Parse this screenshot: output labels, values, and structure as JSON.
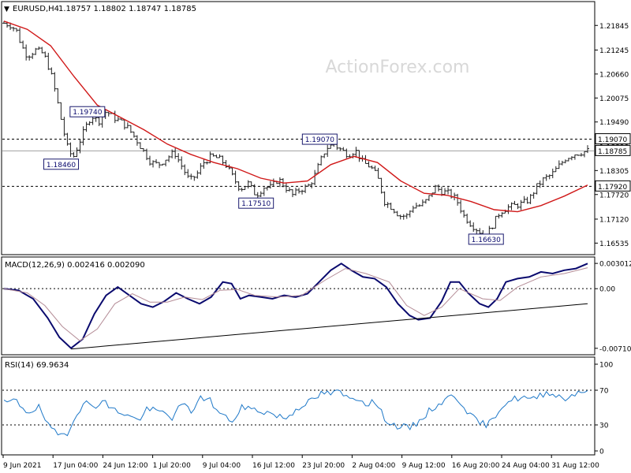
{
  "watermark": "ActionForex.com",
  "header": {
    "symbol": "EURUSD,H4",
    "ohlc": "1.18757 1.18802 1.18747 1.18785"
  },
  "colors": {
    "bar": "#202020",
    "sma": "#d01818",
    "macd": "#0a0a6e",
    "signal": "#b48c96",
    "rsi": "#1e78c8",
    "grid": "#000000",
    "tag_text": "#0a0a6e",
    "watermark": "#d8d8d8"
  },
  "chart_data": [
    {
      "type": "ohlc",
      "name": "price",
      "symbol": "EURUSD",
      "timeframe": "H4",
      "ylim": [
        1.1635,
        1.2235
      ],
      "yticks": [
        "1.21845",
        "1.21245",
        "1.20660",
        "1.20075",
        "1.19490",
        "1.18890",
        "1.18305",
        "1.17720",
        "1.17120",
        "1.16535"
      ],
      "current_price": "1.18785",
      "hlines": [
        {
          "value": 1.1907,
          "label": "1.19070",
          "style": "dashed"
        },
        {
          "value": 1.1792,
          "label": "1.17920",
          "style": "dashed"
        },
        {
          "value": 1.18785,
          "style": "solid-grey"
        }
      ],
      "annotations": [
        {
          "text": "1.19740",
          "x": 0.143,
          "y": 1.1974
        },
        {
          "text": "1.18460",
          "x": 0.098,
          "y": 1.1846
        },
        {
          "text": "1.17510",
          "x": 0.432,
          "y": 1.1751
        },
        {
          "text": "1.19070",
          "x": 0.541,
          "y": 1.1907
        },
        {
          "text": "1.16630",
          "x": 0.826,
          "y": 1.1663
        }
      ],
      "close_path": [
        [
          0.0,
          1.219
        ],
        [
          0.012,
          1.2185
        ],
        [
          0.022,
          1.217
        ],
        [
          0.03,
          1.2135
        ],
        [
          0.04,
          1.211
        ],
        [
          0.055,
          1.2125
        ],
        [
          0.068,
          1.2115
        ],
        [
          0.08,
          1.207
        ],
        [
          0.09,
          1.201
        ],
        [
          0.098,
          1.1955
        ],
        [
          0.108,
          1.189
        ],
        [
          0.118,
          1.186
        ],
        [
          0.128,
          1.1895
        ],
        [
          0.138,
          1.193
        ],
        [
          0.15,
          1.1965
        ],
        [
          0.162,
          1.195
        ],
        [
          0.175,
          1.1975
        ],
        [
          0.188,
          1.196
        ],
        [
          0.2,
          1.195
        ],
        [
          0.212,
          1.1935
        ],
        [
          0.225,
          1.191
        ],
        [
          0.238,
          1.188
        ],
        [
          0.252,
          1.185
        ],
        [
          0.265,
          1.1845
        ],
        [
          0.278,
          1.186
        ],
        [
          0.292,
          1.1875
        ],
        [
          0.305,
          1.184
        ],
        [
          0.318,
          1.1805
        ],
        [
          0.33,
          1.182
        ],
        [
          0.342,
          1.185
        ],
        [
          0.355,
          1.1865
        ],
        [
          0.368,
          1.186
        ],
        [
          0.38,
          1.1845
        ],
        [
          0.392,
          1.1815
        ],
        [
          0.405,
          1.1785
        ],
        [
          0.418,
          1.18
        ],
        [
          0.432,
          1.177
        ],
        [
          0.445,
          1.179
        ],
        [
          0.458,
          1.179
        ],
        [
          0.47,
          1.181
        ],
        [
          0.482,
          1.179
        ],
        [
          0.495,
          1.177
        ],
        [
          0.508,
          1.1785
        ],
        [
          0.52,
          1.179
        ],
        [
          0.53,
          1.181
        ],
        [
          0.541,
          1.185
        ],
        [
          0.552,
          1.1885
        ],
        [
          0.565,
          1.1895
        ],
        [
          0.578,
          1.188
        ],
        [
          0.59,
          1.187
        ],
        [
          0.602,
          1.188
        ],
        [
          0.615,
          1.185
        ],
        [
          0.628,
          1.184
        ],
        [
          0.64,
          1.1815
        ],
        [
          0.652,
          1.1755
        ],
        [
          0.665,
          1.174
        ],
        [
          0.678,
          1.172
        ],
        [
          0.69,
          1.172
        ],
        [
          0.702,
          1.1745
        ],
        [
          0.714,
          1.1745
        ],
        [
          0.726,
          1.176
        ],
        [
          0.738,
          1.179
        ],
        [
          0.75,
          1.178
        ],
        [
          0.762,
          1.1775
        ],
        [
          0.775,
          1.176
        ],
        [
          0.788,
          1.172
        ],
        [
          0.8,
          1.17
        ],
        [
          0.812,
          1.1685
        ],
        [
          0.826,
          1.167
        ],
        [
          0.838,
          1.17
        ],
        [
          0.85,
          1.173
        ],
        [
          0.862,
          1.174
        ],
        [
          0.875,
          1.1745
        ],
        [
          0.888,
          1.175
        ],
        [
          0.9,
          1.176
        ],
        [
          0.912,
          1.179
        ],
        [
          0.925,
          1.181
        ],
        [
          0.938,
          1.182
        ],
        [
          0.95,
          1.184
        ],
        [
          0.962,
          1.186
        ],
        [
          0.975,
          1.187
        ],
        [
          1.0,
          1.18785
        ]
      ],
      "sma_path": [
        [
          0.0,
          1.2195
        ],
        [
          0.04,
          1.2175
        ],
        [
          0.08,
          1.2135
        ],
        [
          0.12,
          1.206
        ],
        [
          0.16,
          1.199
        ],
        [
          0.2,
          1.196
        ],
        [
          0.24,
          1.193
        ],
        [
          0.28,
          1.1895
        ],
        [
          0.32,
          1.187
        ],
        [
          0.36,
          1.185
        ],
        [
          0.4,
          1.1835
        ],
        [
          0.44,
          1.1812
        ],
        [
          0.48,
          1.18
        ],
        [
          0.52,
          1.1805
        ],
        [
          0.56,
          1.1845
        ],
        [
          0.6,
          1.1865
        ],
        [
          0.64,
          1.185
        ],
        [
          0.68,
          1.1805
        ],
        [
          0.72,
          1.1775
        ],
        [
          0.76,
          1.177
        ],
        [
          0.8,
          1.1755
        ],
        [
          0.84,
          1.1735
        ],
        [
          0.88,
          1.173
        ],
        [
          0.92,
          1.1745
        ],
        [
          0.96,
          1.1768
        ],
        [
          1.0,
          1.1795
        ]
      ]
    },
    {
      "type": "line",
      "name": "macd",
      "label": "MACD(12,26,9) 0.002416 0.002090",
      "ylim": [
        -0.0075,
        0.0034
      ],
      "yticks": [
        "0.003012",
        "0.00",
        "-0.007109"
      ],
      "series": [
        {
          "role": "macd",
          "points": [
            [
              0.0,
              0.0
            ],
            [
              0.025,
              -0.0002
            ],
            [
              0.05,
              -0.0012
            ],
            [
              0.075,
              -0.0035
            ],
            [
              0.095,
              -0.0058
            ],
            [
              0.115,
              -0.0071
            ],
            [
              0.135,
              -0.006
            ],
            [
              0.155,
              -0.003
            ],
            [
              0.175,
              -0.0008
            ],
            [
              0.195,
              0.0002
            ],
            [
              0.215,
              -0.0008
            ],
            [
              0.235,
              -0.0018
            ],
            [
              0.255,
              -0.0022
            ],
            [
              0.275,
              -0.0015
            ],
            [
              0.295,
              -0.0005
            ],
            [
              0.315,
              -0.0012
            ],
            [
              0.335,
              -0.0018
            ],
            [
              0.355,
              -0.001
            ],
            [
              0.375,
              0.0008
            ],
            [
              0.39,
              0.0006
            ],
            [
              0.405,
              -0.0012
            ],
            [
              0.42,
              -0.0008
            ],
            [
              0.44,
              -0.001
            ],
            [
              0.46,
              -0.0012
            ],
            [
              0.48,
              -0.0008
            ],
            [
              0.5,
              -0.001
            ],
            [
              0.52,
              -0.0006
            ],
            [
              0.54,
              0.0008
            ],
            [
              0.56,
              0.0022
            ],
            [
              0.578,
              0.003
            ],
            [
              0.595,
              0.0022
            ],
            [
              0.615,
              0.0014
            ],
            [
              0.635,
              0.0012
            ],
            [
              0.655,
              0.0002
            ],
            [
              0.675,
              -0.0018
            ],
            [
              0.695,
              -0.0032
            ],
            [
              0.71,
              -0.0037
            ],
            [
              0.73,
              -0.0035
            ],
            [
              0.75,
              -0.0015
            ],
            [
              0.765,
              0.0008
            ],
            [
              0.78,
              0.0008
            ],
            [
              0.795,
              -0.0005
            ],
            [
              0.815,
              -0.0018
            ],
            [
              0.83,
              -0.0022
            ],
            [
              0.845,
              -0.0012
            ],
            [
              0.86,
              0.0008
            ],
            [
              0.88,
              0.0012
            ],
            [
              0.9,
              0.0014
            ],
            [
              0.92,
              0.002
            ],
            [
              0.94,
              0.0018
            ],
            [
              0.96,
              0.0022
            ],
            [
              0.98,
              0.0024
            ],
            [
              1.0,
              0.003
            ]
          ]
        },
        {
          "role": "signal",
          "points": [
            [
              0.0,
              0.0
            ],
            [
              0.04,
              -0.0005
            ],
            [
              0.07,
              -0.002
            ],
            [
              0.1,
              -0.0045
            ],
            [
              0.13,
              -0.0062
            ],
            [
              0.16,
              -0.0048
            ],
            [
              0.19,
              -0.0018
            ],
            [
              0.22,
              -0.0006
            ],
            [
              0.25,
              -0.0016
            ],
            [
              0.28,
              -0.0016
            ],
            [
              0.31,
              -0.001
            ],
            [
              0.34,
              -0.0013
            ],
            [
              0.37,
              -0.0002
            ],
            [
              0.4,
              -0.0001
            ],
            [
              0.43,
              -0.0008
            ],
            [
              0.47,
              -0.001
            ],
            [
              0.51,
              -0.0008
            ],
            [
              0.55,
              0.001
            ],
            [
              0.585,
              0.0024
            ],
            [
              0.62,
              0.0018
            ],
            [
              0.66,
              0.0008
            ],
            [
              0.69,
              -0.002
            ],
            [
              0.72,
              -0.0032
            ],
            [
              0.75,
              -0.0022
            ],
            [
              0.78,
              0.0
            ],
            [
              0.82,
              -0.0012
            ],
            [
              0.85,
              -0.0014
            ],
            [
              0.88,
              0.0002
            ],
            [
              0.92,
              0.0014
            ],
            [
              0.96,
              0.0018
            ],
            [
              1.0,
              0.0025
            ]
          ]
        },
        {
          "role": "trendline",
          "points": [
            [
              0.115,
              -0.0072
            ],
            [
              1.0,
              -0.0018
            ]
          ]
        }
      ]
    },
    {
      "type": "line",
      "name": "rsi",
      "label": "RSI(14) 69.9634",
      "ylim": [
        0,
        100
      ],
      "yticks": [
        "100",
        "70",
        "30",
        "0"
      ],
      "levels": [
        70,
        30
      ],
      "points": [
        [
          0.0,
          55
        ],
        [
          0.02,
          58
        ],
        [
          0.04,
          45
        ],
        [
          0.06,
          50
        ],
        [
          0.08,
          24
        ],
        [
          0.095,
          18
        ],
        [
          0.11,
          22
        ],
        [
          0.125,
          45
        ],
        [
          0.14,
          55
        ],
        [
          0.155,
          52
        ],
        [
          0.17,
          58
        ],
        [
          0.185,
          48
        ],
        [
          0.2,
          45
        ],
        [
          0.215,
          40
        ],
        [
          0.23,
          35
        ],
        [
          0.245,
          48
        ],
        [
          0.26,
          46
        ],
        [
          0.275,
          44
        ],
        [
          0.29,
          38
        ],
        [
          0.305,
          55
        ],
        [
          0.32,
          45
        ],
        [
          0.335,
          60
        ],
        [
          0.35,
          62
        ],
        [
          0.365,
          46
        ],
        [
          0.38,
          38
        ],
        [
          0.395,
          35
        ],
        [
          0.41,
          52
        ],
        [
          0.425,
          48
        ],
        [
          0.44,
          46
        ],
        [
          0.455,
          44
        ],
        [
          0.47,
          40
        ],
        [
          0.485,
          38
        ],
        [
          0.5,
          48
        ],
        [
          0.515,
          55
        ],
        [
          0.53,
          58
        ],
        [
          0.545,
          67
        ],
        [
          0.56,
          66
        ],
        [
          0.575,
          68
        ],
        [
          0.59,
          60
        ],
        [
          0.605,
          62
        ],
        [
          0.62,
          55
        ],
        [
          0.635,
          57
        ],
        [
          0.65,
          40
        ],
        [
          0.665,
          30
        ],
        [
          0.68,
          28
        ],
        [
          0.695,
          26
        ],
        [
          0.71,
          33
        ],
        [
          0.725,
          44
        ],
        [
          0.74,
          52
        ],
        [
          0.755,
          58
        ],
        [
          0.77,
          65
        ],
        [
          0.785,
          55
        ],
        [
          0.8,
          40
        ],
        [
          0.815,
          32
        ],
        [
          0.83,
          30
        ],
        [
          0.845,
          45
        ],
        [
          0.86,
          56
        ],
        [
          0.875,
          60
        ],
        [
          0.89,
          62
        ],
        [
          0.905,
          58
        ],
        [
          0.92,
          65
        ],
        [
          0.935,
          68
        ],
        [
          0.95,
          63
        ],
        [
          0.965,
          60
        ],
        [
          0.98,
          68
        ],
        [
          1.0,
          70
        ]
      ]
    }
  ],
  "xaxis": {
    "labels": [
      "9 Jun 2021",
      "17 Jun 04:00",
      "24 Jun 12:00",
      "1 Jul 20:00",
      "9 Jul 04:00",
      "16 Jul 12:00",
      "23 Jul 20:00",
      "2 Aug 04:00",
      "9 Aug 12:00",
      "16 Aug 20:00",
      "24 Aug 04:00",
      "31 Aug 12:00"
    ]
  }
}
